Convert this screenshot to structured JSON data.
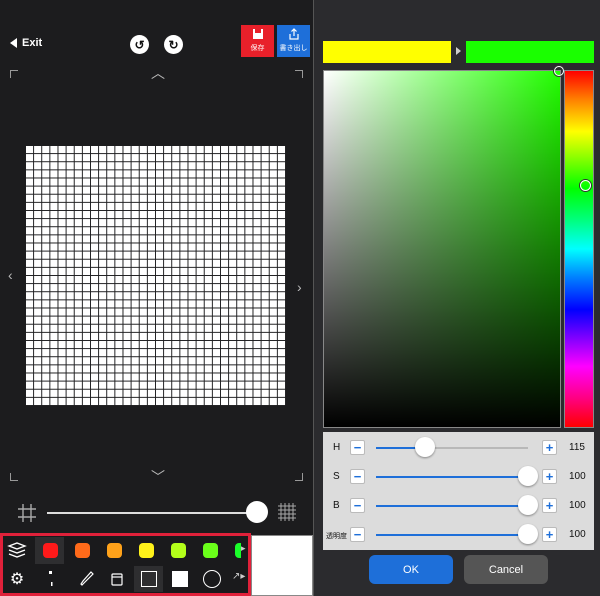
{
  "editor": {
    "exit_label": "Exit",
    "undo_icon": "undo-icon",
    "redo_icon": "redo-icon",
    "save_label": "保存",
    "export_label": "書き出し",
    "colors": {
      "save_bg": "#e8202a",
      "export_bg": "#1e6fd9",
      "canvas_bg": "#1c1c1e",
      "highlight_border": "#e0213a"
    }
  },
  "toolbar": {
    "swatches": [
      "#ff1a1a",
      "#ff6a1a",
      "#ffa21a",
      "#fff21a",
      "#b3ff1a",
      "#6aff1a",
      "#1aff2a"
    ],
    "tools": [
      "layers-icon",
      "settings-icon",
      "pen-size-icon",
      "eyedropper-icon",
      "bucket-icon",
      "square-outline-icon",
      "square-fill-icon",
      "circle-outline-icon",
      "more-icon"
    ]
  },
  "color_picker": {
    "previous_color": "#ffff00",
    "new_color": "#1aff00",
    "hue_base": "#22ff00",
    "sliders": [
      {
        "label": "H",
        "value": "115",
        "fraction": 0.32
      },
      {
        "label": "S",
        "value": "100",
        "fraction": 1.0
      },
      {
        "label": "B",
        "value": "100",
        "fraction": 1.0
      },
      {
        "label": "透明度",
        "value": "100",
        "fraction": 1.0
      }
    ],
    "ok_label": "OK",
    "cancel_label": "Cancel",
    "ok_color": "#1e6fd9",
    "cancel_color": "#555555"
  }
}
